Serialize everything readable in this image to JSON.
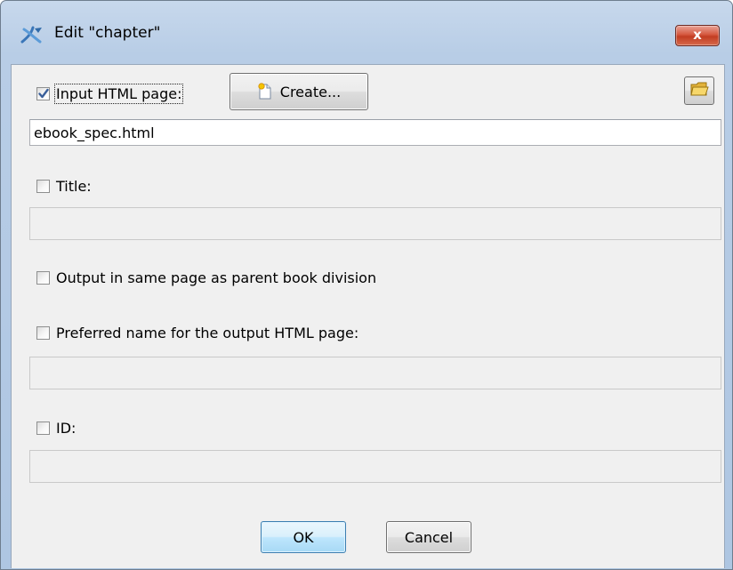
{
  "window": {
    "title": "Edit \"chapter\"",
    "close_label": "x",
    "app_icon": "xmlmind-icon"
  },
  "input_page": {
    "checked": true,
    "label": "Input HTML page:",
    "create_label": "Create...",
    "value": "ebook_spec.html"
  },
  "title_field": {
    "checked": false,
    "label": "Title:",
    "value": ""
  },
  "same_page": {
    "checked": false,
    "label": "Output in same page as parent book division"
  },
  "preferred_name": {
    "checked": false,
    "label": "Preferred name for the output HTML page:",
    "value": ""
  },
  "id_field": {
    "checked": false,
    "label": "ID:",
    "value": ""
  },
  "buttons": {
    "ok_label": "OK",
    "cancel_label": "Cancel"
  }
}
